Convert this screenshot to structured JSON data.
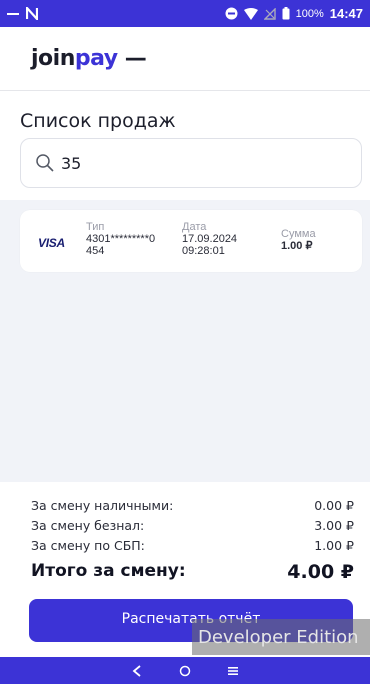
{
  "status_bar": {
    "battery": "100%",
    "time": "14:47"
  },
  "logo": {
    "part1": "join",
    "part2": "pay",
    "part3": " —"
  },
  "page_title": "Список продаж",
  "search": {
    "value": "35"
  },
  "transactions": [
    {
      "card_brand": "VISA",
      "type_label": "Тип",
      "card_number_line1": "4301*********0",
      "card_number_line2": "454",
      "date_label": "Дата",
      "date": "17.09.2024",
      "time": "09:28:01",
      "amount_label": "Сумма",
      "amount": "1.00 ₽"
    }
  ],
  "totals": {
    "cash_label": "За смену наличными:",
    "cash_value": "0.00 ₽",
    "noncash_label": "За смену безнал:",
    "noncash_value": "3.00 ₽",
    "sbp_label": "За смену по СБП:",
    "sbp_value": "1.00 ₽",
    "total_label": "Итого за смену:",
    "total_value": "4.00 ₽"
  },
  "print_button": "Распечатать отчёт",
  "watermark": "Developer Edition",
  "colors": {
    "accent": "#3c33d6",
    "background_list": "#f1f3f8",
    "text_dark": "#1d1f2c"
  }
}
